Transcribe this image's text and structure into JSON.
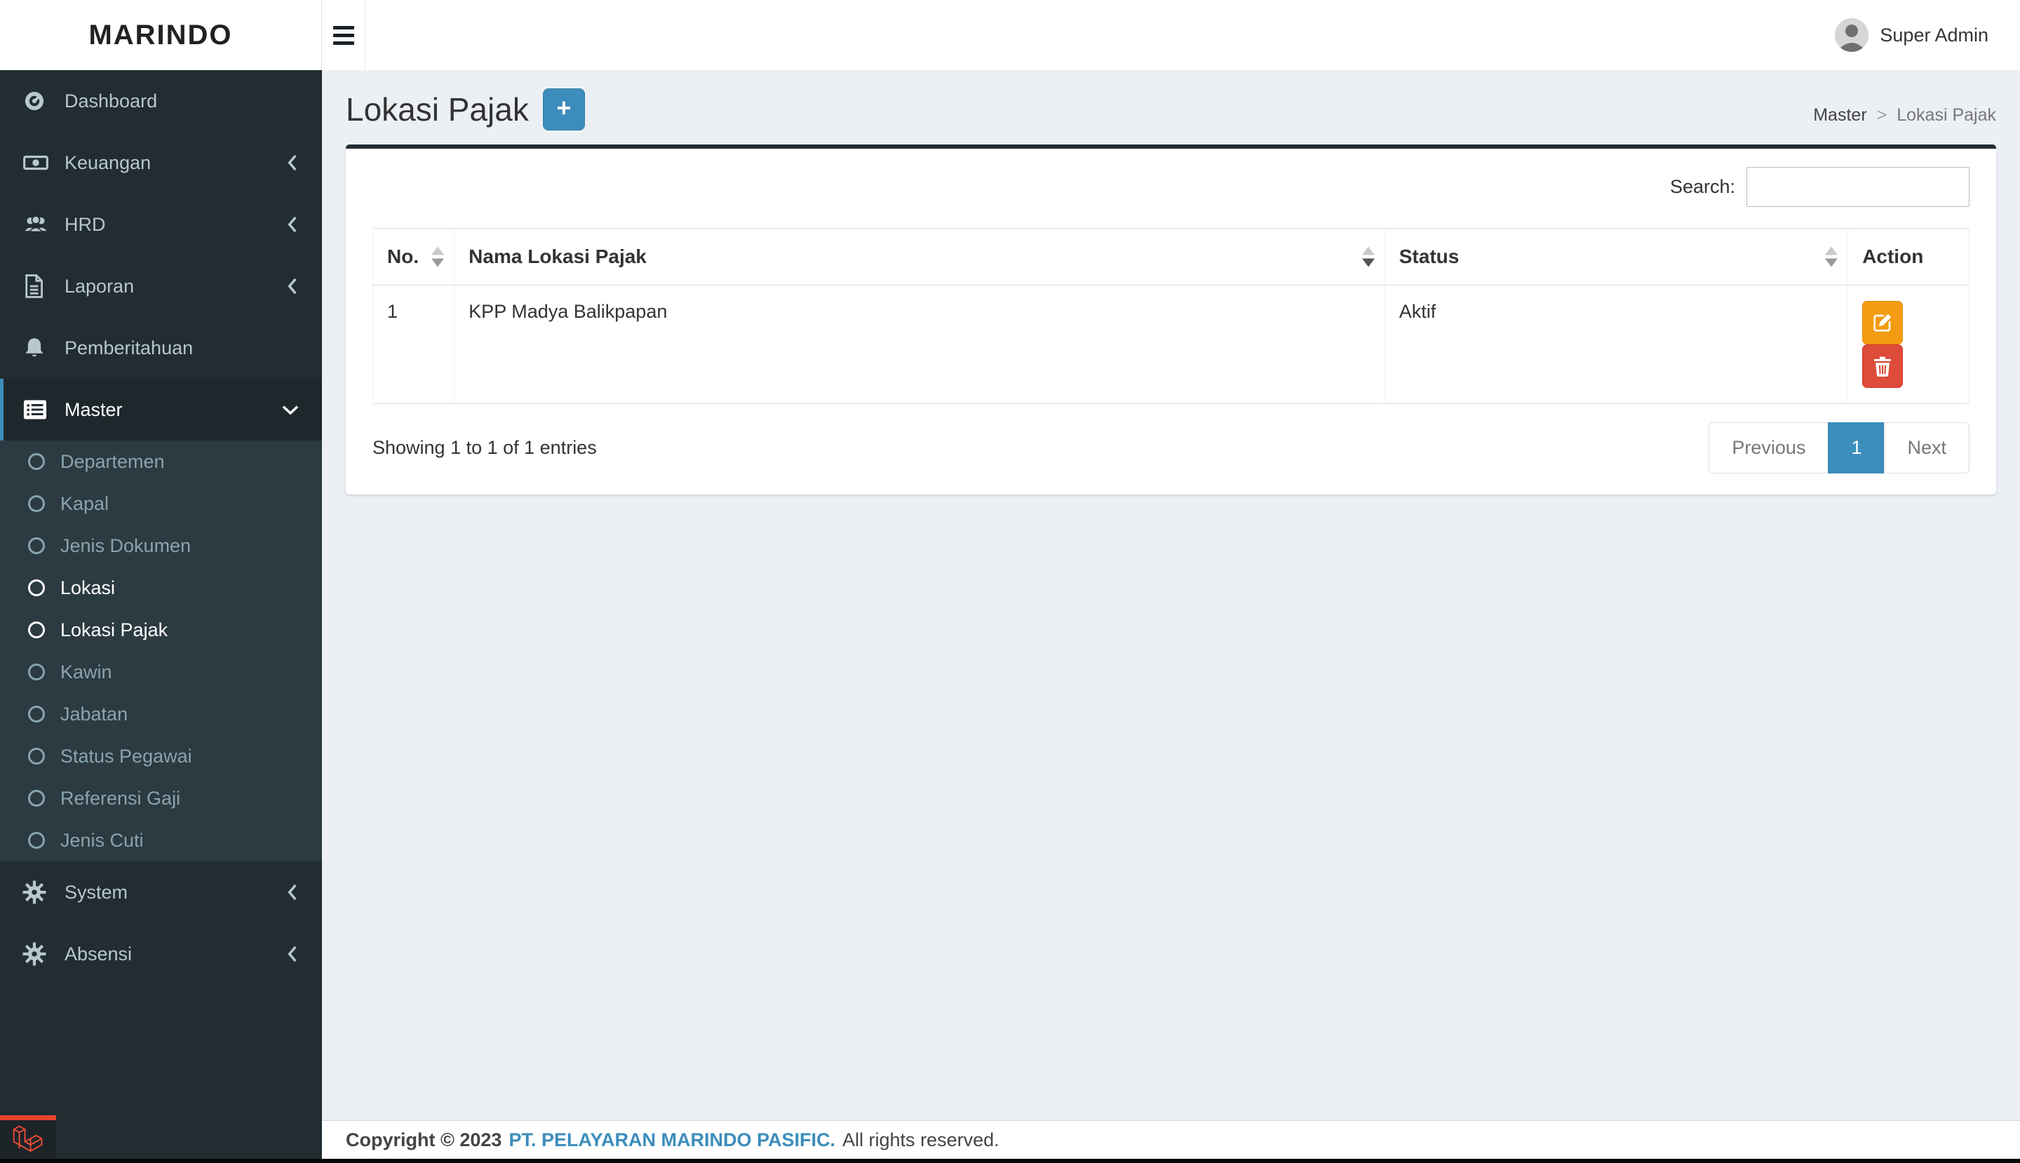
{
  "app": {
    "brand": "MARINDO",
    "user_name": "Super Admin"
  },
  "sidebar": {
    "items": [
      {
        "label": "Dashboard"
      },
      {
        "label": "Keuangan"
      },
      {
        "label": "HRD"
      },
      {
        "label": "Laporan"
      },
      {
        "label": "Pemberitahuan"
      },
      {
        "label": "Master"
      },
      {
        "label": "System"
      },
      {
        "label": "Absensi"
      }
    ],
    "master_submenu": [
      {
        "label": "Departemen"
      },
      {
        "label": "Kapal"
      },
      {
        "label": "Jenis Dokumen"
      },
      {
        "label": "Lokasi"
      },
      {
        "label": "Lokasi Pajak"
      },
      {
        "label": "Kawin"
      },
      {
        "label": "Jabatan"
      },
      {
        "label": "Status Pegawai"
      },
      {
        "label": "Referensi Gaji"
      },
      {
        "label": "Jenis Cuti"
      }
    ]
  },
  "page": {
    "title": "Lokasi Pajak",
    "add_label": "+",
    "breadcrumb": [
      "Master",
      "Lokasi Pajak"
    ],
    "breadcrumb_divider": ">"
  },
  "table": {
    "search_label": "Search:",
    "search_value": "",
    "headers": [
      {
        "label": "No."
      },
      {
        "label": "Nama Lokasi Pajak"
      },
      {
        "label": "Status"
      },
      {
        "label": "Action"
      }
    ],
    "rows": [
      {
        "no": "1",
        "nama": "KPP Madya Balikpapan",
        "status": "Aktif"
      }
    ],
    "info": "Showing 1 to 1 of 1 entries",
    "pagination": {
      "previous": "Previous",
      "current": "1",
      "next": "Next"
    }
  },
  "footer": {
    "copyright": "Copyright © 2023",
    "company": "PT. PELAYARAN MARINDO PASIFIC.",
    "rights": "All rights reserved."
  },
  "colors": {
    "accent_blue": "#3c8dbc",
    "warning_orange": "#f39c12",
    "danger_red": "#dd4b39",
    "sidebar_dark": "#222d32",
    "submenu_dark": "#2c3b41",
    "content_bg": "#ecf0f5",
    "laravel_red": "#e8422e"
  }
}
